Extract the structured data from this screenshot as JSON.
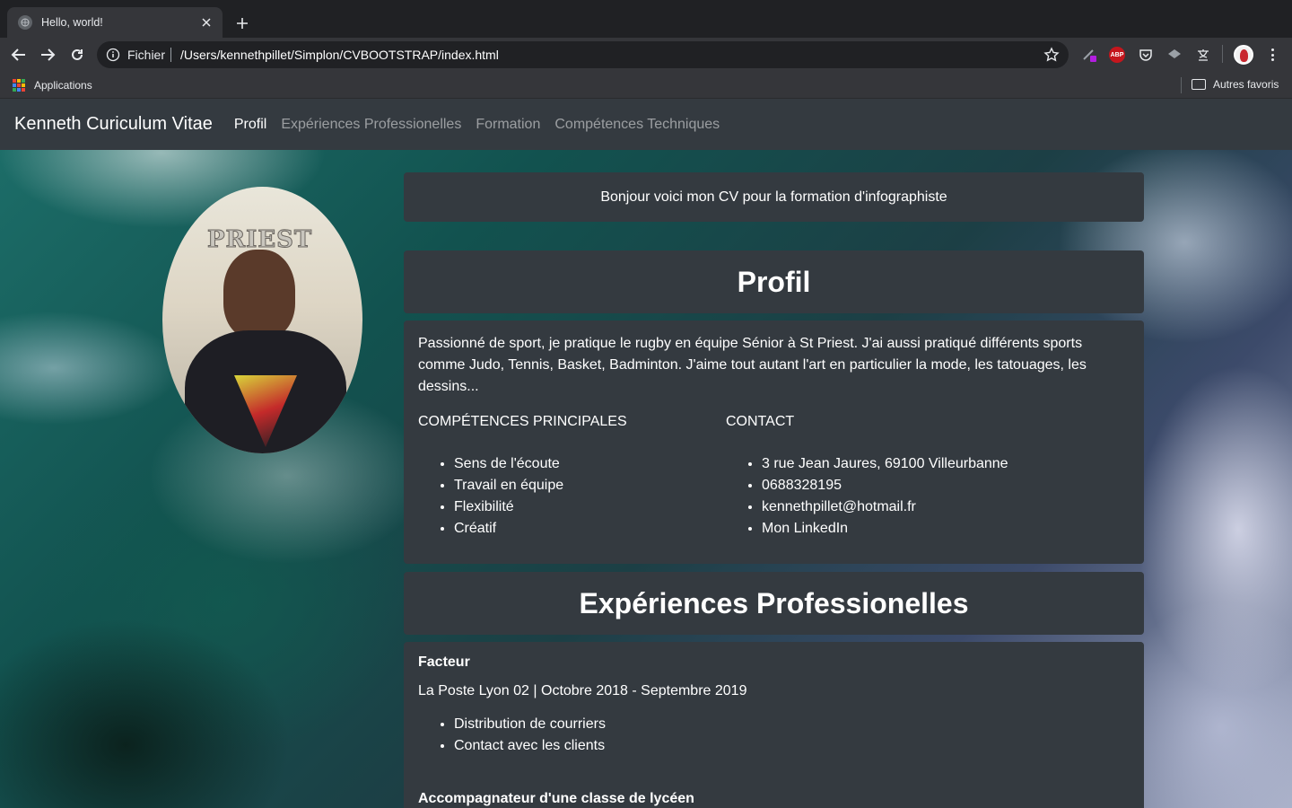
{
  "browser": {
    "tab_title": "Hello, world!",
    "scheme_label": "Fichier",
    "url": "/Users/kennethpillet/Simplon/CVBOOTSTRAP/index.html",
    "bookmarks_apps": "Applications",
    "bookmarks_other": "Autres favoris",
    "abp_label": "ABP"
  },
  "navbar": {
    "brand": "Kenneth Curiculum Vitae",
    "links": [
      "Profil",
      "Expériences Professionelles",
      "Formation",
      "Compétences Techniques"
    ],
    "active": "Profil"
  },
  "intro": "Bonjour voici mon CV pour la formation d'infographiste",
  "profil": {
    "heading": "Profil",
    "paragraph": "Passionné de sport, je pratique le rugby en équipe Sénior à St Priest. J'ai aussi pratiqué différents sports comme Judo, Tennis, Basket, Badminton. J'aime tout autant l'art en particulier la mode, les tatouages, les dessins...",
    "skills_title": "COMPÉTENCES PRINCIPALES",
    "skills": [
      "Sens de l'écoute",
      "Travail en équipe",
      "Flexibilité",
      "Créatif"
    ],
    "contact_title": "CONTACT",
    "contact": [
      "3 rue Jean Jaures, 69100 Villeurbanne",
      "0688328195",
      "kennethpillet@hotmail.fr",
      "Mon LinkedIn"
    ]
  },
  "experiences": {
    "heading": "Expériences Professionelles",
    "jobs": [
      {
        "title": "Facteur",
        "meta": "La Poste Lyon 02 | Octobre 2018 - Septembre 2019",
        "tasks": [
          "Distribution de courriers",
          "Contact avec les clients"
        ]
      },
      {
        "title": "Accompagnateur d'une classe de lycéen"
      }
    ]
  },
  "photo": {
    "banner_text": "PRIEST"
  },
  "colors": {
    "navbar_bg": "#343a40",
    "card_bg": "#343a40",
    "chrome_dark": "#202124",
    "chrome_toolbar": "#35363a"
  }
}
